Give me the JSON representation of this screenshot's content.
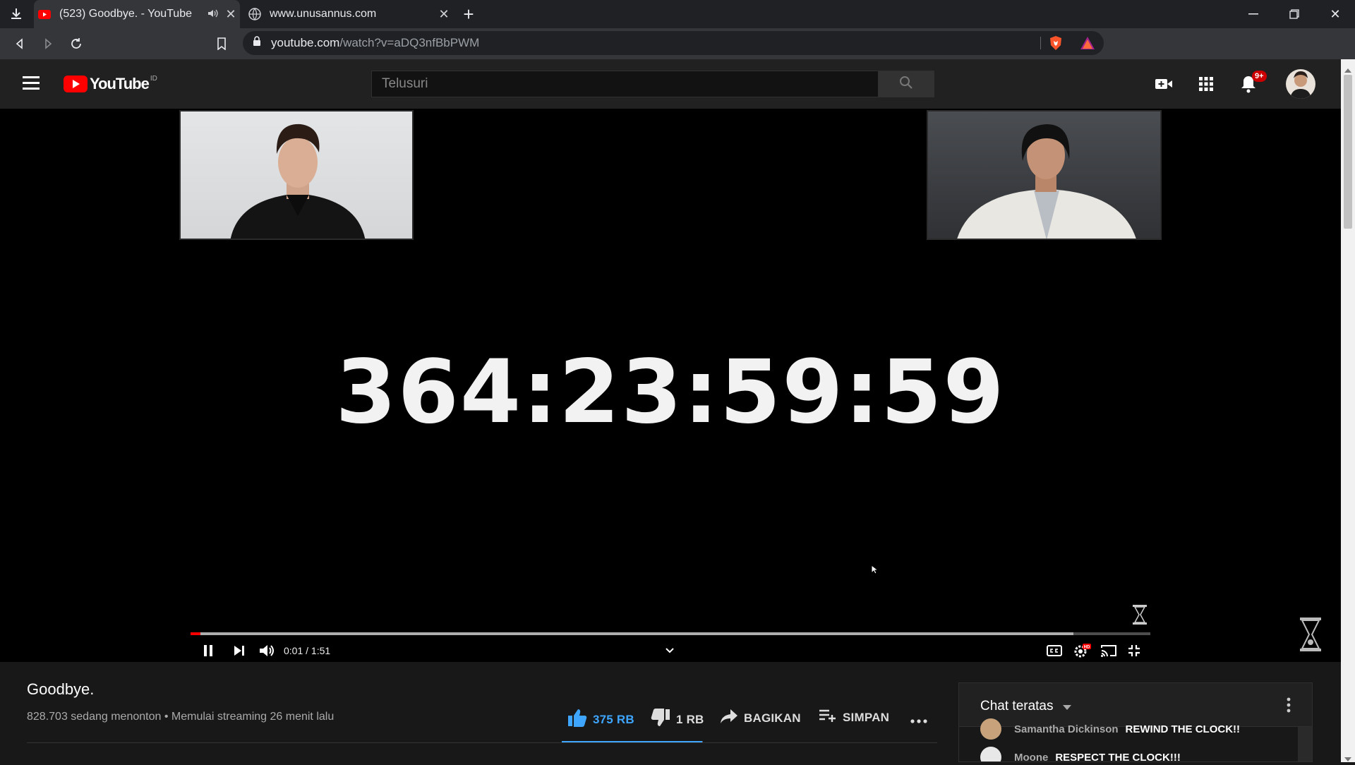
{
  "browser": {
    "tabs": [
      {
        "title": "(523) Goodbye. - YouTube",
        "favicon": "youtube-icon",
        "audio": true,
        "active": true
      },
      {
        "title": "www.unusannus.com",
        "favicon": "globe-icon",
        "active": false
      }
    ],
    "url": {
      "host": "youtube.com",
      "path": "/watch?v=aDQ3nfBbPWM"
    },
    "extensions": [
      "brave-shields-icon",
      "brave-rewards-icon",
      "bitwarden-icon",
      "leaf-icon",
      "extension-icon",
      "puzzle-icon",
      "media-queue-icon",
      "menu-icon"
    ]
  },
  "youtube": {
    "logo": {
      "word": "YouTube",
      "country": "ID"
    },
    "search": {
      "placeholder": "Telusuri"
    },
    "notifications_badge": "9+"
  },
  "player": {
    "countdown": "364:23:59:59",
    "time_current": "0:01",
    "time_separator": "/",
    "time_total": "1:51",
    "progress_fraction": 0.01,
    "buffered_fraction": 0.92
  },
  "video": {
    "title": "Goodbye.",
    "viewers": "828.703 sedang menonton",
    "separator": "•",
    "started": "Memulai streaming 26 menit lalu",
    "actions": {
      "like": "375 RB",
      "dislike": "1 RB",
      "share": "BAGIKAN",
      "save": "SIMPAN"
    },
    "like_ratio": 0.997
  },
  "chat": {
    "title": "Chat teratas",
    "messages": [
      {
        "author": "Samantha Dickinson",
        "text": "REWIND THE CLOCK!!"
      },
      {
        "author": "Moone",
        "text": "RESPECT THE CLOCK!!!"
      }
    ]
  },
  "colors": {
    "accent": "#ff0000",
    "like_blue": "#3ea6ff",
    "chrome_bg": "#202124"
  }
}
